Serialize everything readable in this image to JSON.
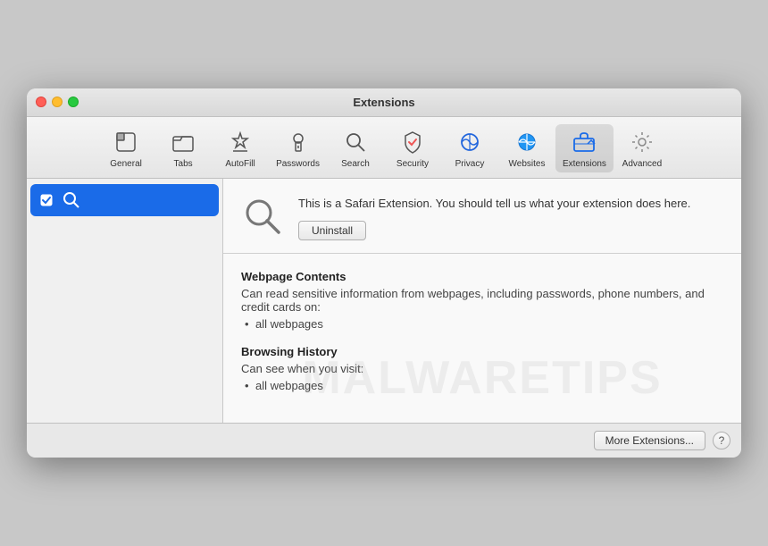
{
  "window": {
    "title": "Extensions"
  },
  "toolbar": {
    "items": [
      {
        "id": "general",
        "label": "General",
        "icon": "general"
      },
      {
        "id": "tabs",
        "label": "Tabs",
        "icon": "tabs"
      },
      {
        "id": "autofill",
        "label": "AutoFill",
        "icon": "autofill"
      },
      {
        "id": "passwords",
        "label": "Passwords",
        "icon": "passwords"
      },
      {
        "id": "search",
        "label": "Search",
        "icon": "search"
      },
      {
        "id": "security",
        "label": "Security",
        "icon": "security"
      },
      {
        "id": "privacy",
        "label": "Privacy",
        "icon": "privacy"
      },
      {
        "id": "websites",
        "label": "Websites",
        "icon": "websites"
      },
      {
        "id": "extensions",
        "label": "Extensions",
        "icon": "extensions",
        "active": true
      },
      {
        "id": "advanced",
        "label": "Advanced",
        "icon": "advanced"
      }
    ]
  },
  "sidebar": {
    "items": [
      {
        "id": "search-ext",
        "name": "Search",
        "checked": true
      }
    ]
  },
  "detail": {
    "description": "This is a Safari Extension. You should tell us what your extension does here.",
    "uninstall_label": "Uninstall",
    "sections": [
      {
        "title": "Webpage Contents",
        "desc": "Can read sensitive information from webpages, including passwords, phone numbers, and credit cards on:",
        "items": [
          "all webpages"
        ]
      },
      {
        "title": "Browsing History",
        "desc": "Can see when you visit:",
        "items": [
          "all webpages"
        ]
      }
    ]
  },
  "bottom_bar": {
    "more_extensions_label": "More Extensions...",
    "help_label": "?"
  },
  "watermark": {
    "text": "MALWARETIPS"
  }
}
